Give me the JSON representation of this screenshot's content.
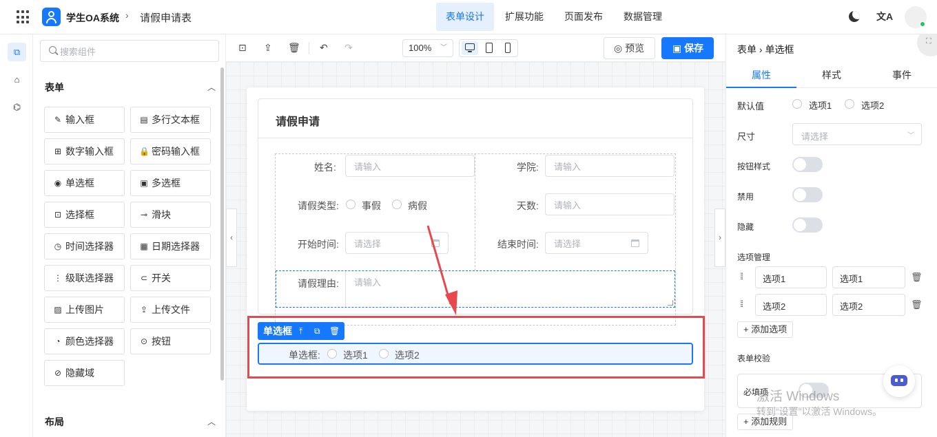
{
  "header": {
    "app_name": "学生OA系统",
    "crumb_sep": "›",
    "page_name": "请假申请表",
    "tabs": [
      "表单设计",
      "扩展功能",
      "页面发布",
      "数据管理"
    ],
    "active_tab": "表单设计",
    "translate_icon": "文A"
  },
  "components": {
    "search_placeholder": "搜索组件",
    "section_form": "表单",
    "section_layout": "布局",
    "items": [
      {
        "label": "输入框",
        "icon": "✎"
      },
      {
        "label": "多行文本框",
        "icon": "▤"
      },
      {
        "label": "数字输入框",
        "icon": "⊞"
      },
      {
        "label": "密码输入框",
        "icon": "🔒"
      },
      {
        "label": "单选框",
        "icon": "◉"
      },
      {
        "label": "多选框",
        "icon": "▣"
      },
      {
        "label": "选择框",
        "icon": "⊡"
      },
      {
        "label": "滑块",
        "icon": "⊸"
      },
      {
        "label": "时间选择器",
        "icon": "◷"
      },
      {
        "label": "日期选择器",
        "icon": "▦"
      },
      {
        "label": "级联选择器",
        "icon": "⋮"
      },
      {
        "label": "开关",
        "icon": "⊂"
      },
      {
        "label": "上传图片",
        "icon": "▨"
      },
      {
        "label": "上传文件",
        "icon": "⇪"
      },
      {
        "label": "颜色选择器",
        "icon": "◔"
      },
      {
        "label": "按钮",
        "icon": "⊙"
      },
      {
        "label": "隐藏域",
        "icon": "⊘"
      }
    ]
  },
  "toolbar": {
    "zoom": "100%",
    "preview_label": "预览",
    "save_label": "保存"
  },
  "form": {
    "title": "请假申请",
    "name_label": "姓名:",
    "college_label": "学院:",
    "type_label": "请假类型:",
    "type_options": [
      "事假",
      "病假"
    ],
    "days_label": "天数:",
    "start_label": "开始时间:",
    "end_label": "结束时间:",
    "reason_label": "请假理由:",
    "input_placeholder": "请输入",
    "select_placeholder": "请选择",
    "selected_tag": "单选框",
    "selected_label": "单选框:",
    "selected_options": [
      "选项1",
      "选项2"
    ]
  },
  "props": {
    "breadcrumb": "表单 › 单选框",
    "tabs": [
      "属性",
      "样式",
      "事件"
    ],
    "active_tab": "属性",
    "default_label": "默认值",
    "default_options": [
      "选项1",
      "选项2"
    ],
    "size_label": "尺寸",
    "size_placeholder": "请选择",
    "button_style_label": "按钮样式",
    "disabled_label": "禁用",
    "hidden_label": "隐藏",
    "options_label": "选项管理",
    "option_rows": [
      {
        "label": "选项1",
        "value": "选项1"
      },
      {
        "label": "选项2",
        "value": "选项2"
      }
    ],
    "add_option": "+ 添加选项",
    "validation_label": "表单校验",
    "required_label": "必填项",
    "add_rule": "+ 添加规则"
  },
  "watermark": {
    "line1": "激活 Windows",
    "line2": "转到“设置”以激活 Windows。"
  },
  "colors": {
    "primary": "#1677ff",
    "annotation_red": "#e8474b"
  }
}
